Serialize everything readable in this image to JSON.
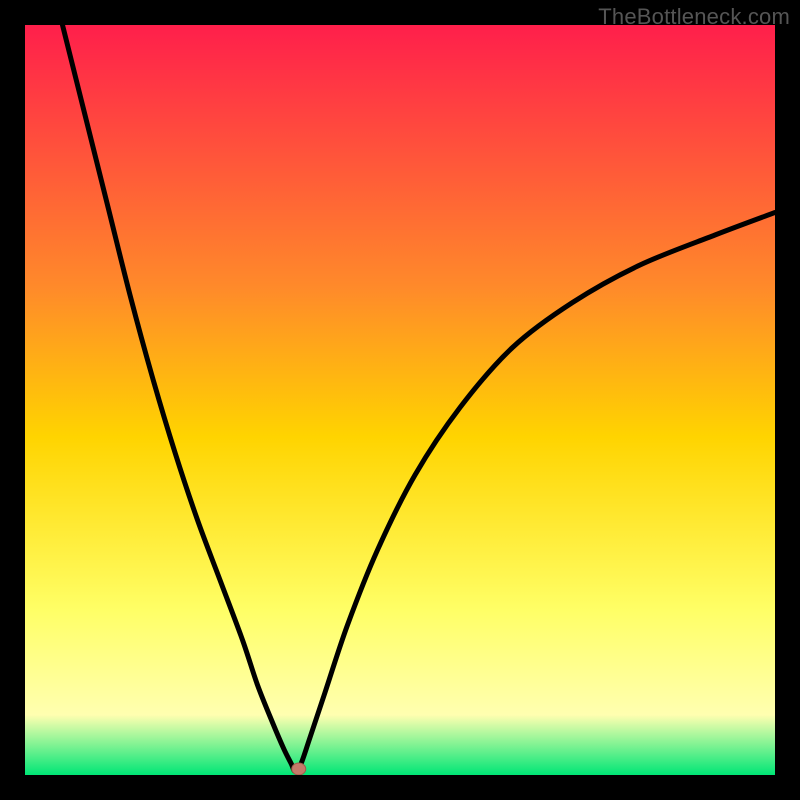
{
  "watermark": "TheBottleneck.com",
  "colors": {
    "gradient_top": "#ff1f4b",
    "gradient_mid_upper": "#ff8a2a",
    "gradient_mid": "#ffd400",
    "gradient_mid_lower": "#ffff66",
    "gradient_lower": "#ffffb0",
    "gradient_bottom": "#00e676",
    "curve": "#000000",
    "marker_fill": "#c47a6a",
    "marker_stroke": "#a05a4a",
    "frame": "#000000"
  },
  "chart_data": {
    "type": "line",
    "title": "",
    "xlabel": "",
    "ylabel": "",
    "xlim": [
      0,
      100
    ],
    "ylim": [
      0,
      100
    ],
    "note": "Axes are unlabeled in source; values are normalized 0–100 from pixel positions. y is plotted with 0 at bottom, 100 at top.",
    "series": [
      {
        "name": "curve",
        "x": [
          5,
          8,
          11,
          14,
          17,
          20,
          23,
          26,
          29,
          31,
          33,
          34.5,
          35.5,
          36,
          36.8,
          38,
          40,
          43,
          47,
          52,
          58,
          65,
          73,
          82,
          92,
          100
        ],
        "y": [
          100,
          88,
          76,
          64,
          53,
          43,
          34,
          26,
          18,
          12,
          7,
          3.5,
          1.5,
          0.5,
          1.5,
          5,
          11,
          20,
          30,
          40,
          49,
          57,
          63,
          68,
          72,
          75
        ]
      }
    ],
    "marker": {
      "x": 36.5,
      "y": 0.8
    }
  }
}
